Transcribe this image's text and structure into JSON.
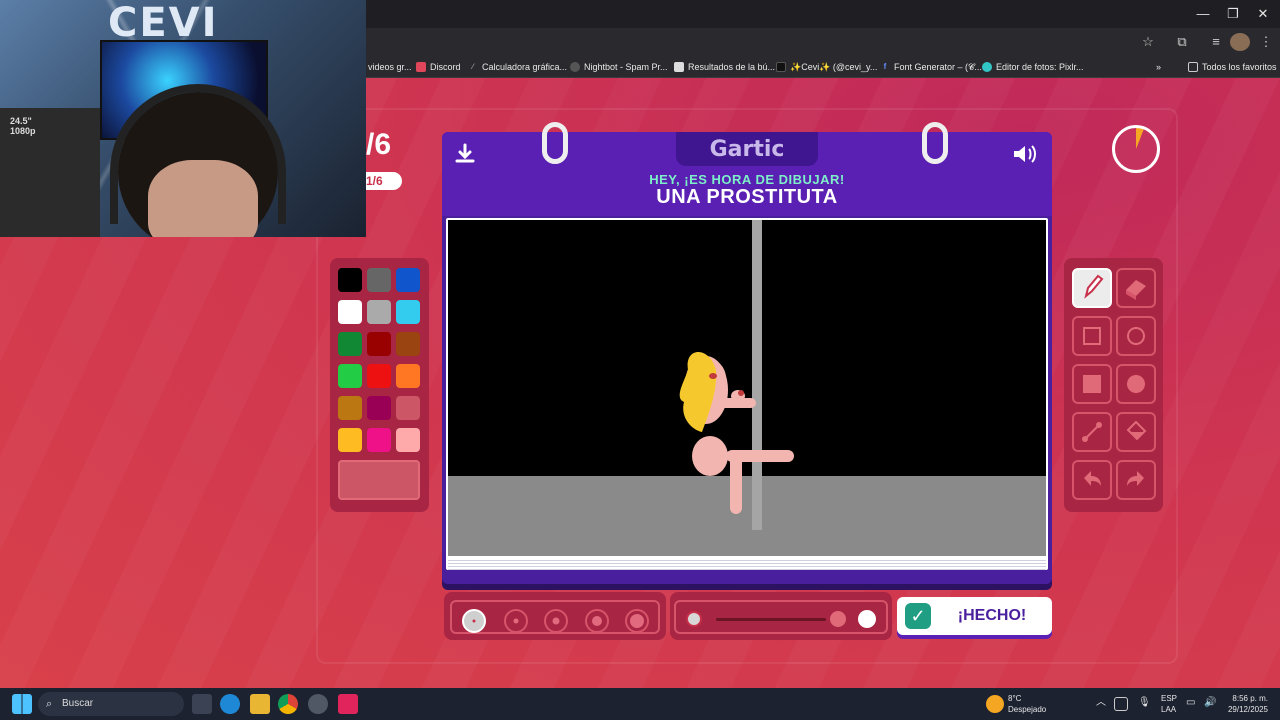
{
  "browser": {
    "window_controls": [
      "—",
      "❐",
      "✕"
    ],
    "bookmarks": [
      {
        "label": "videos gr...",
        "icon": "folder-icon",
        "color": "#2a2a2e"
      },
      {
        "label": "Discord",
        "icon": "discord-icon",
        "color": "#e0465a"
      },
      {
        "label": "Calculadora gráfica...",
        "icon": "desmos-icon",
        "color": "#555555"
      },
      {
        "label": "Nightbot - Spam Pr...",
        "icon": "nightbot-icon",
        "color": "#444444"
      },
      {
        "label": "Resultados de la bú...",
        "icon": "doc-icon",
        "color": "#dddddd"
      },
      {
        "label": "✨Cevi✨ (@cevi_y...",
        "icon": "tiktok-icon",
        "color": "#111111"
      },
      {
        "label": "Font Generator – (𝓒...",
        "icon": "font-icon",
        "color": "#3a5bd9"
      },
      {
        "label": "Editor de fotos: Pixlr...",
        "icon": "pixlr-icon",
        "color": "#32c7c7"
      }
    ],
    "all_bookmarks": "Todos los favoritos"
  },
  "webcam": {
    "logo_text": "CEVI",
    "monitor_label_line1": "24.5\"",
    "monitor_label_line2": "1080p"
  },
  "game": {
    "round_big": "/6",
    "round_pill": "1/6",
    "logo": "Gartic",
    "hint": "HEY, ¡ES HORA DE DIBUJAR!",
    "word": "UNA PROSTITUTA",
    "timer_fraction": 0.06,
    "palette": [
      "#000000",
      "#666666",
      "#1155cc",
      "#ffffff",
      "#aaaaaa",
      "#33ccee",
      "#118833",
      "#990000",
      "#994411",
      "#22cc44",
      "#ee1111",
      "#ff7722",
      "#bb7711",
      "#990055",
      "#cc5566",
      "#ffbb22",
      "#ee1188",
      "#ffaaaa"
    ],
    "selected_color": "#cc5566",
    "tools": [
      "pencil-icon",
      "eraser-icon",
      "rectangle-icon",
      "ellipse-icon",
      "filled-rectangle-icon",
      "filled-ellipse-icon",
      "line-icon",
      "fill-bucket-icon",
      "undo-icon",
      "redo-icon"
    ],
    "active_tool": "pencil-icon",
    "brush_size_index": 0,
    "done_label": "¡HECHO!"
  },
  "taskbar": {
    "search_placeholder": "Buscar",
    "weather_temp": "8°C",
    "weather_desc": "Despejado",
    "lang1": "ESP",
    "lang2": "LAA",
    "time": "8:56 p. m.",
    "date": "29/12/2025"
  }
}
